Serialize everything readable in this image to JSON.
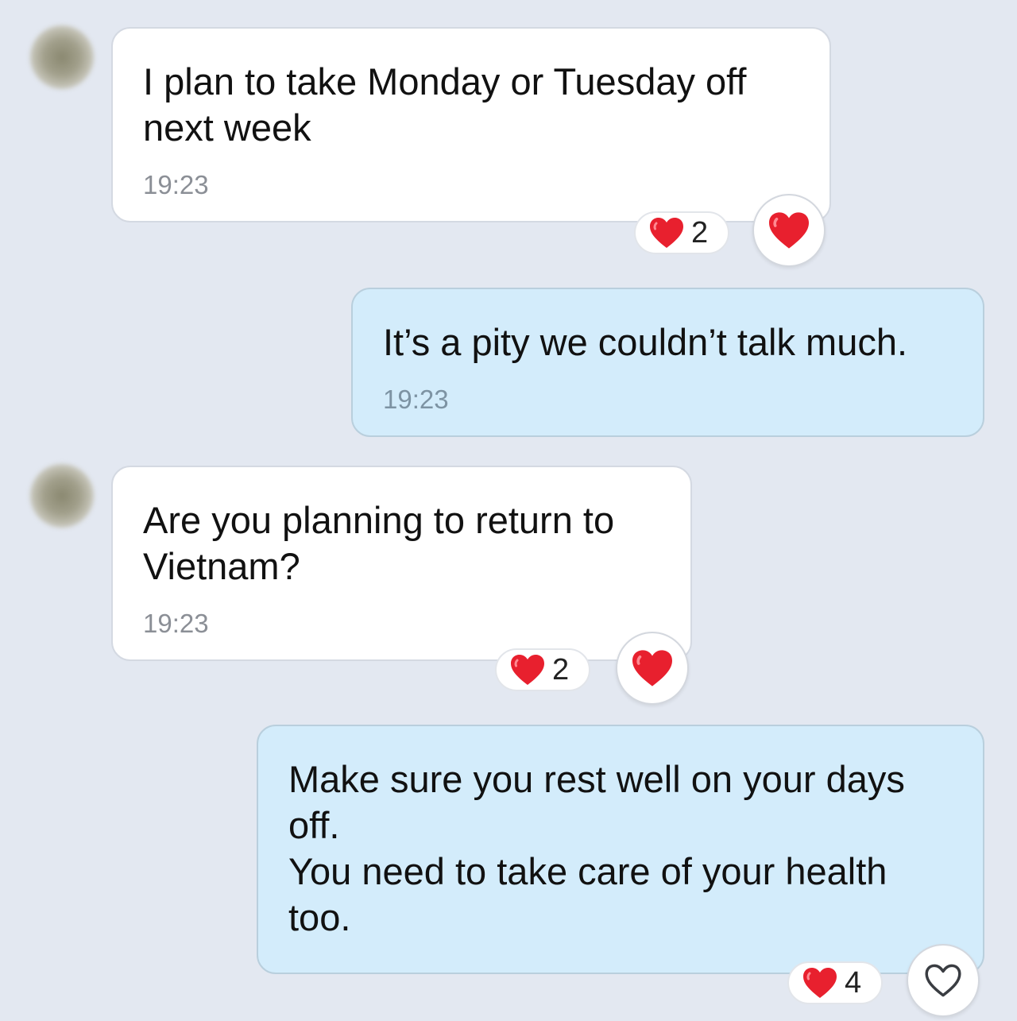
{
  "colors": {
    "background": "#e3e8f1",
    "incoming_bubble": "#ffffff",
    "outgoing_bubble": "#d3ecfb",
    "heart": "#e8202e"
  },
  "messages": [
    {
      "direction": "incoming",
      "text": "I plan to take Monday or Tuesday off\nnext week",
      "time": "19:23",
      "reaction": {
        "icon": "red-heart",
        "count": "2",
        "my_reaction": "red-heart"
      }
    },
    {
      "direction": "outgoing",
      "text": "It’s a pity we couldn’t talk much.",
      "time": "19:23"
    },
    {
      "direction": "incoming",
      "text": "Are you planning to return to\nVietnam?",
      "time": "19:23",
      "reaction": {
        "icon": "red-heart",
        "count": "2",
        "my_reaction": "red-heart"
      }
    },
    {
      "direction": "outgoing",
      "text": "Make sure you rest well on your days\noff.\nYou need to take care of your health\ntoo.",
      "time": "",
      "reaction": {
        "icon": "red-heart",
        "count": "4",
        "my_reaction": "outline-heart"
      }
    }
  ]
}
